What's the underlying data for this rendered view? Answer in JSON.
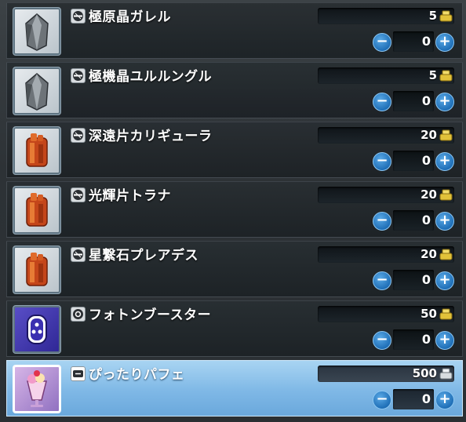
{
  "items": [
    {
      "name": "極原晶ガレル",
      "price": "5",
      "qty": "0",
      "icon": "crystal-icon",
      "tag": "weapon-tag-icon",
      "selected": false
    },
    {
      "name": "極機晶ユルルングル",
      "price": "5",
      "qty": "0",
      "icon": "crystal-icon",
      "tag": "weapon-tag-icon",
      "selected": false
    },
    {
      "name": "深遠片カリギューラ",
      "price": "20",
      "qty": "0",
      "icon": "fragment-icon",
      "tag": "weapon-tag-icon",
      "selected": false
    },
    {
      "name": "光輝片トラナ",
      "price": "20",
      "qty": "0",
      "icon": "fragment-icon",
      "tag": "weapon-tag-icon",
      "selected": false
    },
    {
      "name": "星繋石プレアデス",
      "price": "20",
      "qty": "0",
      "icon": "fragment-icon",
      "tag": "weapon-tag-icon",
      "selected": false
    },
    {
      "name": "フォトンブースター",
      "price": "50",
      "qty": "0",
      "icon": "photon-booster-icon",
      "tag": "consumable-tag-icon",
      "selected": false
    },
    {
      "name": "ぴったりパフェ",
      "price": "500",
      "qty": "0",
      "icon": "parfait-icon",
      "tag": "food-tag-icon",
      "selected": true
    }
  ],
  "controls": {
    "minus": "−",
    "plus": "+"
  },
  "colors": {
    "accent": "#1f6fb7",
    "selected_bg": "#7fb8e6",
    "coin": "#e2c23a"
  }
}
